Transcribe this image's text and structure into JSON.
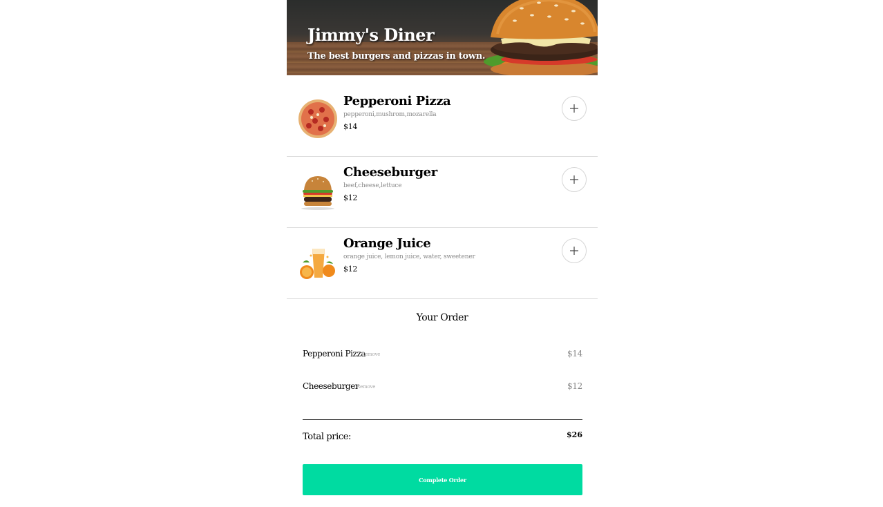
{
  "header": {
    "title": "Jimmy's Diner",
    "subtitle": "The best burgers and pizzas in town."
  },
  "menu": [
    {
      "name": "Pepperoni Pizza",
      "ingredients": "pepperoni,mushrom,mozarella",
      "price": "$14",
      "image": "pizza-image"
    },
    {
      "name": "Cheeseburger",
      "ingredients": "beef,cheese,lettuce",
      "price": "$12",
      "image": "burger-image"
    },
    {
      "name": "Orange Juice",
      "ingredients": "orange juice, lemon juice, water, sweetener",
      "price": "$12",
      "image": "juice-image"
    }
  ],
  "order": {
    "title": "Your Order",
    "items": [
      {
        "name": "Pepperoni Pizza",
        "remove_label": "Remove",
        "price": "$14"
      },
      {
        "name": "Cheeseburger",
        "remove_label": "Remove",
        "price": "$12"
      }
    ],
    "total_label": "Total price:",
    "total_value": "$26",
    "complete_label": "Complete Order"
  },
  "icons": {
    "add": "plus-icon"
  },
  "colors": {
    "accent": "#00dba1",
    "divider": "#dcdcdc",
    "muted_text": "#888888"
  }
}
